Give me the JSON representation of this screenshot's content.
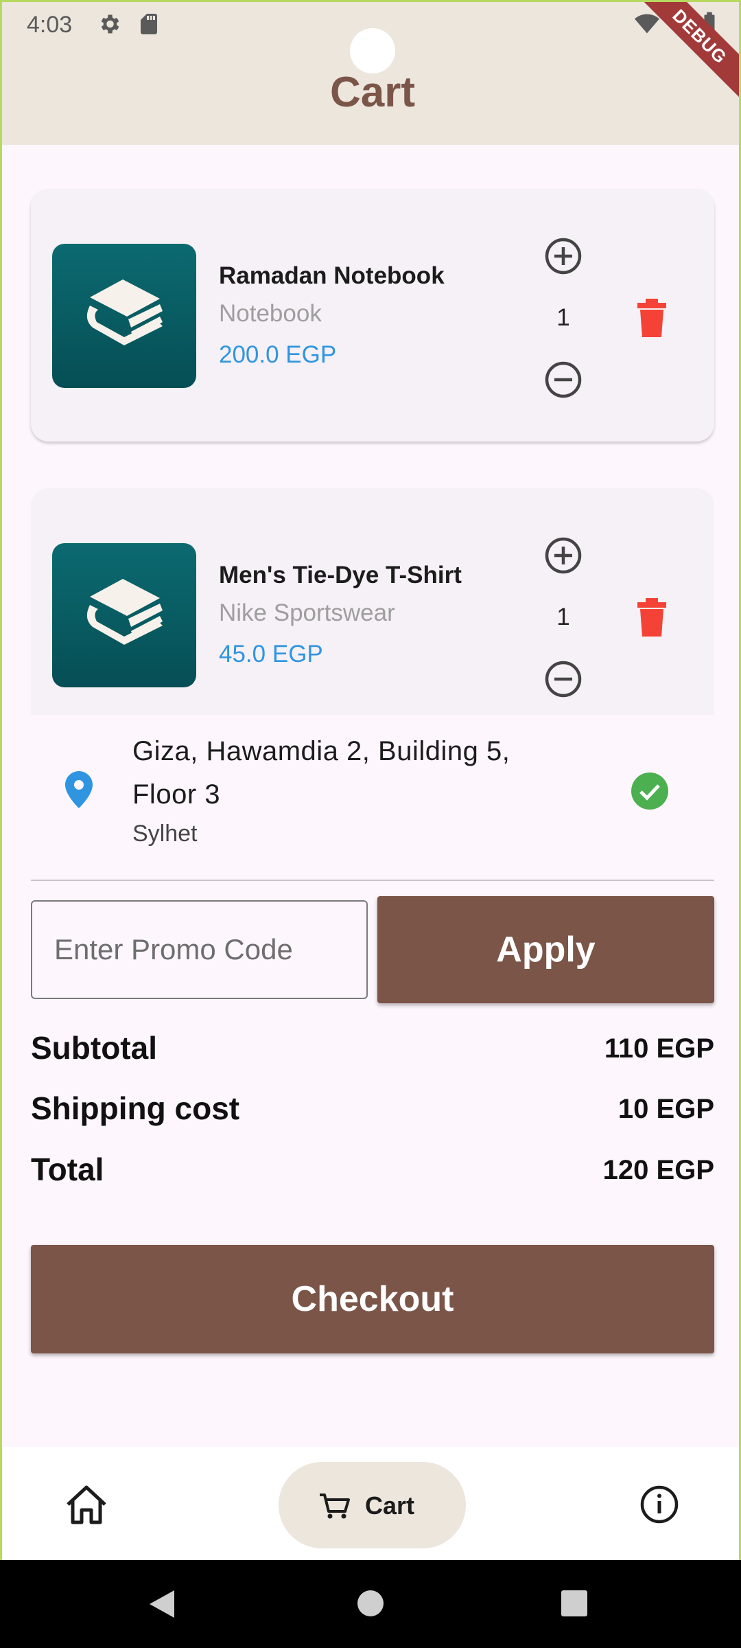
{
  "status_bar": {
    "time": "4:03",
    "icons": [
      "gear-icon",
      "sd-card-icon",
      "wifi-icon",
      "battery-icon"
    ]
  },
  "app_bar": {
    "title": "Cart",
    "debug_banner": "DEBUG"
  },
  "cart_items": [
    {
      "name": "Ramadan Notebook",
      "brand": "Notebook",
      "price": "200.0 EGP",
      "quantity": "1"
    },
    {
      "name": "Men's Tie-Dye T-Shirt",
      "brand": "Nike Sportswear",
      "price": "45.0 EGP",
      "quantity": "1"
    }
  ],
  "address": {
    "line": "Giza, Hawamdia 2, Building 5, Floor 3",
    "city": "Sylhet"
  },
  "promo": {
    "placeholder": "Enter Promo Code",
    "value": "",
    "apply_label": "Apply"
  },
  "summary": {
    "subtotal_label": "Subtotal",
    "subtotal_value": "110 EGP",
    "shipping_label": "Shipping cost",
    "shipping_value": "10 EGP",
    "total_label": "Total",
    "total_value": "120 EGP"
  },
  "checkout_label": "Checkout",
  "bottom_nav": {
    "items": [
      {
        "icon": "home-icon"
      },
      {
        "icon": "cart-icon",
        "label": "Cart",
        "selected": true
      },
      {
        "icon": "info-icon"
      }
    ]
  },
  "colors": {
    "primary": "#7a5548",
    "price": "#2f95e0",
    "delete": "#f44336",
    "success": "#4caf50",
    "accent_bg": "#ece6dd"
  }
}
